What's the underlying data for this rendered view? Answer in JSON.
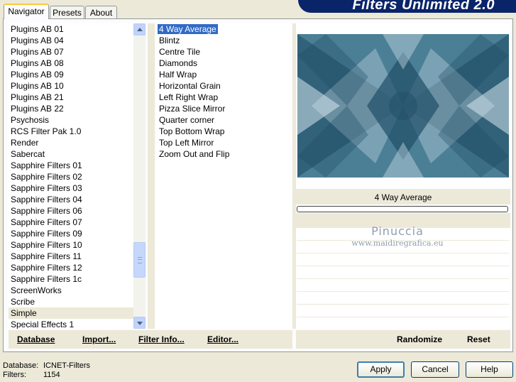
{
  "banner": {
    "title": "Filters Unlimited 2.0"
  },
  "tabs": [
    {
      "label": "Navigator"
    },
    {
      "label": "Presets"
    },
    {
      "label": "About"
    }
  ],
  "categories": [
    "Plugins AB 01",
    "Plugins AB 04",
    "Plugins AB 07",
    "Plugins AB 08",
    "Plugins AB 09",
    "Plugins AB 10",
    "Plugins AB 21",
    "Plugins AB 22",
    "Psychosis",
    "RCS Filter Pak 1.0",
    "Render",
    "Sabercat",
    "Sapphire Filters 01",
    "Sapphire Filters 02",
    "Sapphire Filters 03",
    "Sapphire Filters 04",
    "Sapphire Filters 06",
    "Sapphire Filters 07",
    "Sapphire Filters 09",
    "Sapphire Filters 10",
    "Sapphire Filters 11",
    "Sapphire Filters 12",
    "Sapphire Filters 1c",
    "ScreenWorks",
    "Scribe",
    "Simple",
    "Special Effects 1"
  ],
  "selected_category": "Simple",
  "filters": [
    "4 Way Average",
    "Blintz",
    "Centre Tile",
    "Diamonds",
    "Half Wrap",
    "Horizontal Grain",
    "Left Right Wrap",
    "Pizza Slice Mirror",
    "Quarter corner",
    "Top Bottom Wrap",
    "Top Left Mirror",
    "Zoom Out and Flip"
  ],
  "selected_filter": "4 Way Average",
  "preview": {
    "filter_name": "4 Way Average",
    "watermark_name": "Pinuccia",
    "watermark_url": "www.maidiregrafica.eu",
    "colors": {
      "dark": "#1f4e66",
      "mid": "#4b7f96",
      "light": "#d6e6ee"
    }
  },
  "toolbar": {
    "database": "Database",
    "import": "Import...",
    "filter_info": "Filter Info...",
    "editor": "Editor...",
    "randomize": "Randomize",
    "reset": "Reset"
  },
  "status": {
    "database_label": "Database:",
    "database_value": "ICNET-Filters",
    "filters_label": "Filters:",
    "filters_value": "1154"
  },
  "buttons": {
    "apply": "Apply",
    "cancel": "Cancel",
    "help": "Help"
  },
  "accent": "#316ac5"
}
